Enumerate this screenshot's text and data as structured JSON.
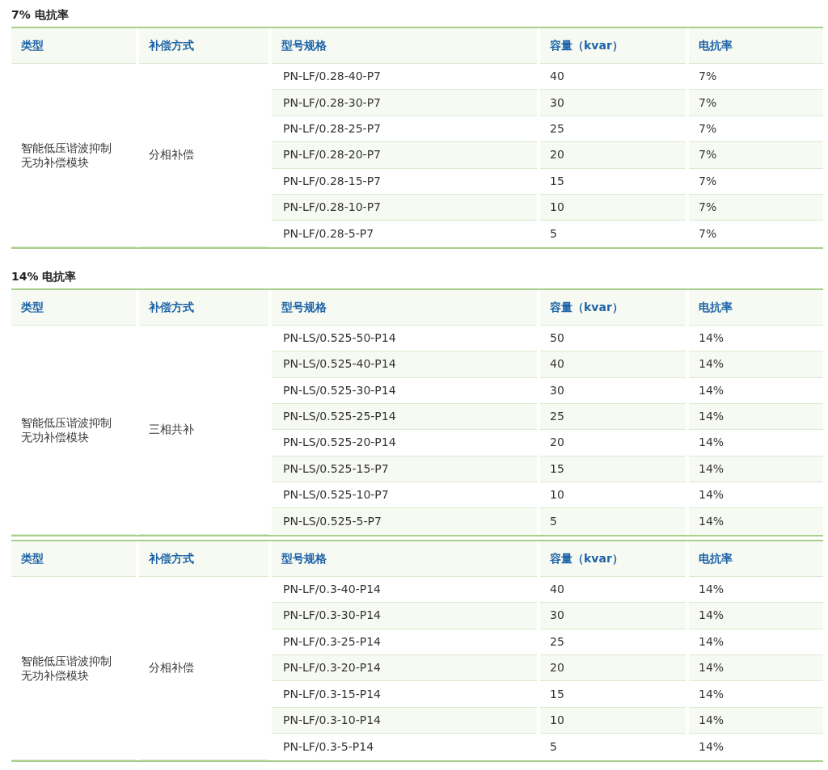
{
  "blocks": [
    {
      "kind": "title",
      "text": "7% 电抗率"
    },
    {
      "kind": "table",
      "columns": [
        "类型",
        "补偿方式",
        "型号规格",
        "容量（kvar）",
        "电抗率"
      ],
      "type": "智能低压谐波抑制无功补偿模块",
      "method": "分相补偿",
      "rows": [
        {
          "model": "PN-LF/0.28-40-P7",
          "capacity": "40",
          "ratio": "7%"
        },
        {
          "model": "PN-LF/0.28-30-P7",
          "capacity": "30",
          "ratio": "7%"
        },
        {
          "model": "PN-LF/0.28-25-P7",
          "capacity": "25",
          "ratio": "7%"
        },
        {
          "model": "PN-LF/0.28-20-P7",
          "capacity": "20",
          "ratio": "7%"
        },
        {
          "model": "PN-LF/0.28-15-P7",
          "capacity": "15",
          "ratio": "7%"
        },
        {
          "model": "PN-LF/0.28-10-P7",
          "capacity": "10",
          "ratio": "7%"
        },
        {
          "model": "PN-LF/0.28-5-P7",
          "capacity": "5",
          "ratio": "7%"
        }
      ]
    },
    {
      "kind": "title",
      "text": "14% 电抗率"
    },
    {
      "kind": "table",
      "columns": [
        "类型",
        "补偿方式",
        "型号规格",
        "容量（kvar）",
        "电抗率"
      ],
      "type": "智能低压谐波抑制无功补偿模块",
      "method": "三相共补",
      "rows": [
        {
          "model": "PN-LS/0.525-50-P14",
          "capacity": "50",
          "ratio": "14%"
        },
        {
          "model": "PN-LS/0.525-40-P14",
          "capacity": "40",
          "ratio": "14%"
        },
        {
          "model": "PN-LS/0.525-30-P14",
          "capacity": "30",
          "ratio": "14%"
        },
        {
          "model": "PN-LS/0.525-25-P14",
          "capacity": "25",
          "ratio": "14%"
        },
        {
          "model": "PN-LS/0.525-20-P14",
          "capacity": "20",
          "ratio": "14%"
        },
        {
          "model": "PN-LS/0.525-15-P7",
          "capacity": "15",
          "ratio": "14%"
        },
        {
          "model": "PN-LS/0.525-10-P7",
          "capacity": "10",
          "ratio": "14%"
        },
        {
          "model": "PN-LS/0.525-5-P7",
          "capacity": "5",
          "ratio": "14%"
        }
      ]
    },
    {
      "kind": "table",
      "columns": [
        "类型",
        "补偿方式",
        "型号规格",
        "容量（kvar）",
        "电抗率"
      ],
      "type": "智能低压谐波抑制无功补偿模块",
      "method": "分相补偿",
      "rows": [
        {
          "model": "PN-LF/0.3-40-P14",
          "capacity": "40",
          "ratio": "14%"
        },
        {
          "model": "PN-LF/0.3-30-P14",
          "capacity": "30",
          "ratio": "14%"
        },
        {
          "model": "PN-LF/0.3-25-P14",
          "capacity": "25",
          "ratio": "14%"
        },
        {
          "model": "PN-LF/0.3-20-P14",
          "capacity": "20",
          "ratio": "14%"
        },
        {
          "model": "PN-LF/0.3-15-P14",
          "capacity": "15",
          "ratio": "14%"
        },
        {
          "model": "PN-LF/0.3-10-P14",
          "capacity": "10",
          "ratio": "14%"
        },
        {
          "model": "PN-LF/0.3-5-P14",
          "capacity": "5",
          "ratio": "14%"
        }
      ]
    }
  ]
}
